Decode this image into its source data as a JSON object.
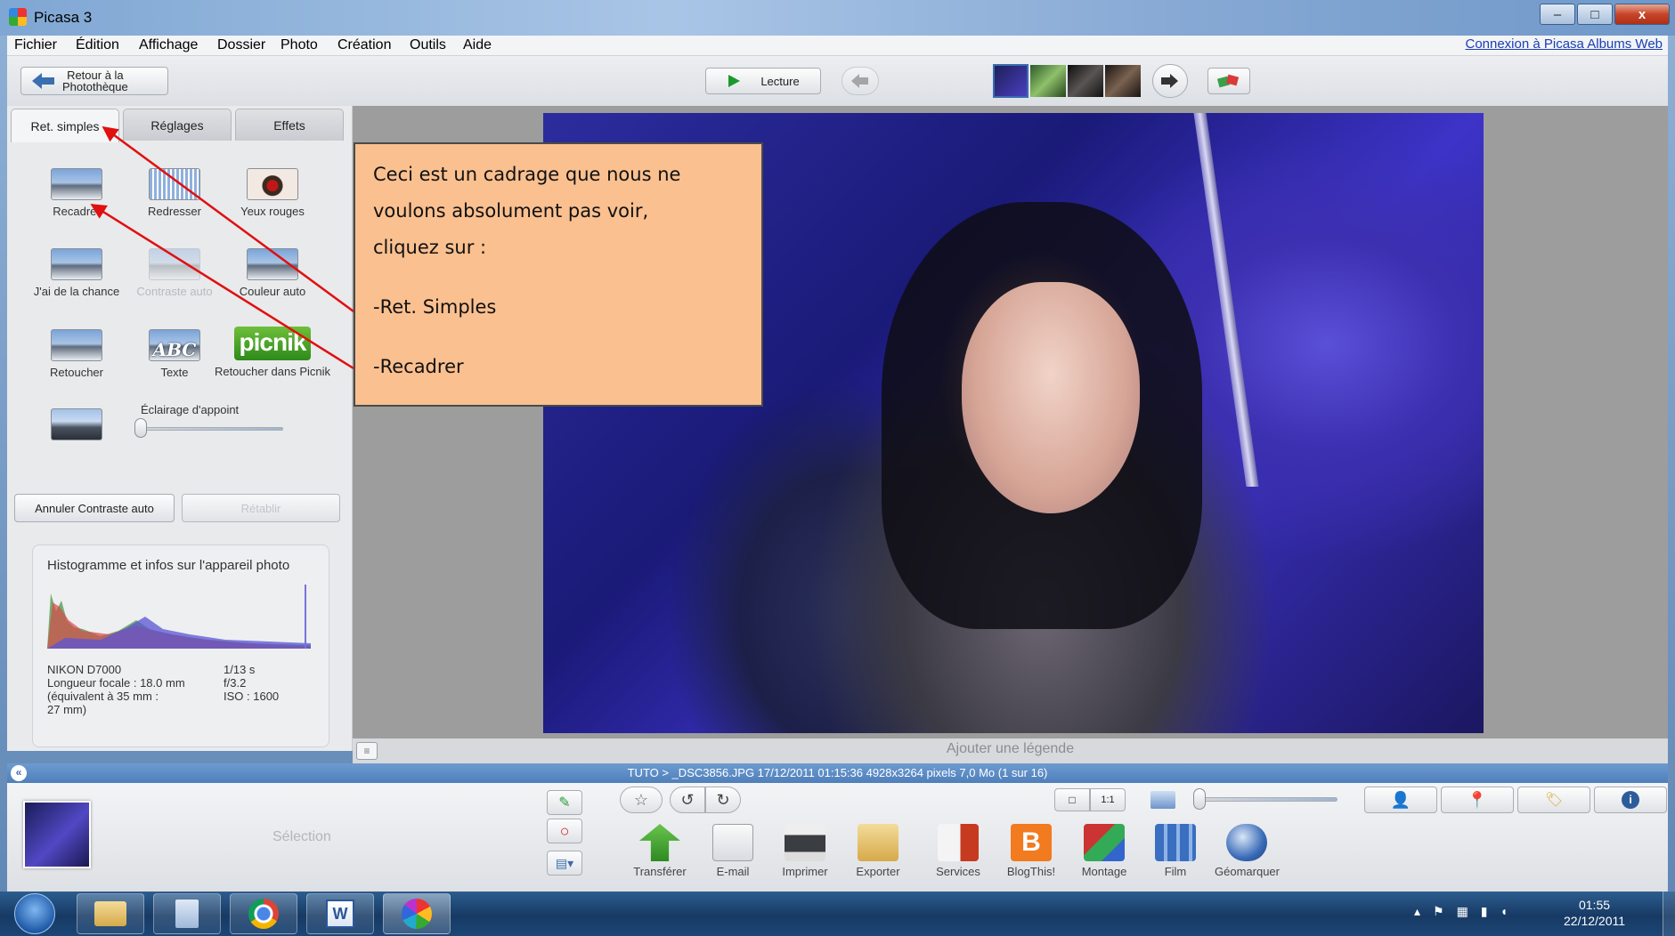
{
  "window": {
    "title": "Picasa 3",
    "minimize": "–",
    "maximize": "□",
    "close": "x"
  },
  "menu": [
    "Fichier",
    "Édition",
    "Affichage",
    "Dossier",
    "Photo",
    "Création",
    "Outils",
    "Aide"
  ],
  "web_link": "Connexion à Picasa Albums Web",
  "toolbar": {
    "back_line1": "Retour à la",
    "back_line2": "Photothèque",
    "play": "Lecture"
  },
  "tabs": [
    "Ret. simples",
    "Réglages",
    "Effets"
  ],
  "tools": [
    {
      "label": "Recadrer",
      "enabled": true
    },
    {
      "label": "Redresser",
      "enabled": true
    },
    {
      "label": "Yeux rouges",
      "enabled": true
    },
    {
      "label": "J'ai de la chance",
      "enabled": true
    },
    {
      "label": "Contraste auto",
      "enabled": false
    },
    {
      "label": "Couleur auto",
      "enabled": true
    },
    {
      "label": "Retoucher",
      "enabled": true
    },
    {
      "label": "Texte",
      "enabled": true
    },
    {
      "label": "Retoucher dans Picnik",
      "enabled": true
    }
  ],
  "picnik_logo": "picnik",
  "abc_label": "ABC",
  "fill_light": {
    "label": "Éclairage d'appoint",
    "value": 0
  },
  "undo_button": "Annuler Contraste auto",
  "redo_button": "Rétablir",
  "histogram": {
    "title": "Histogramme et infos sur l'appareil photo",
    "camera": "NIKON D7000",
    "focal": "Longueur focale : 18.0 mm",
    "equiv1": "(équivalent à 35 mm :",
    "equiv2": "27 mm)",
    "shutter": "1/13 s",
    "aperture": "f/3.2",
    "iso": "ISO : 1600"
  },
  "callout": {
    "line1": "Ceci est un cadrage que nous ne",
    "line2": "voulons absolument pas voir,",
    "line3": "cliquez sur :",
    "item1": "-Ret. Simples",
    "item2": "-Recadrer"
  },
  "caption_placeholder": "Ajouter une légende",
  "status": "TUTO > _DSC3856.JPG     17/12/2011 01:15:36     4928x3264 pixels     7,0 Mo     (1 sur 16)",
  "selection_label": "Sélection",
  "bottom_actions": [
    "Transférer",
    "E-mail",
    "Imprimer",
    "Exporter",
    "Services",
    "BlogThis!",
    "Montage",
    "Film",
    "Géomarquer"
  ],
  "zoom_labels": {
    "fit": "□",
    "one_to_one": "1:1"
  },
  "clock": {
    "time": "01:55",
    "date": "22/12/2011"
  },
  "colors": {
    "accent": "#4f7fbb",
    "callout_bg": "#fac090",
    "arrow": "#e01010",
    "link": "#1a3fb5"
  }
}
